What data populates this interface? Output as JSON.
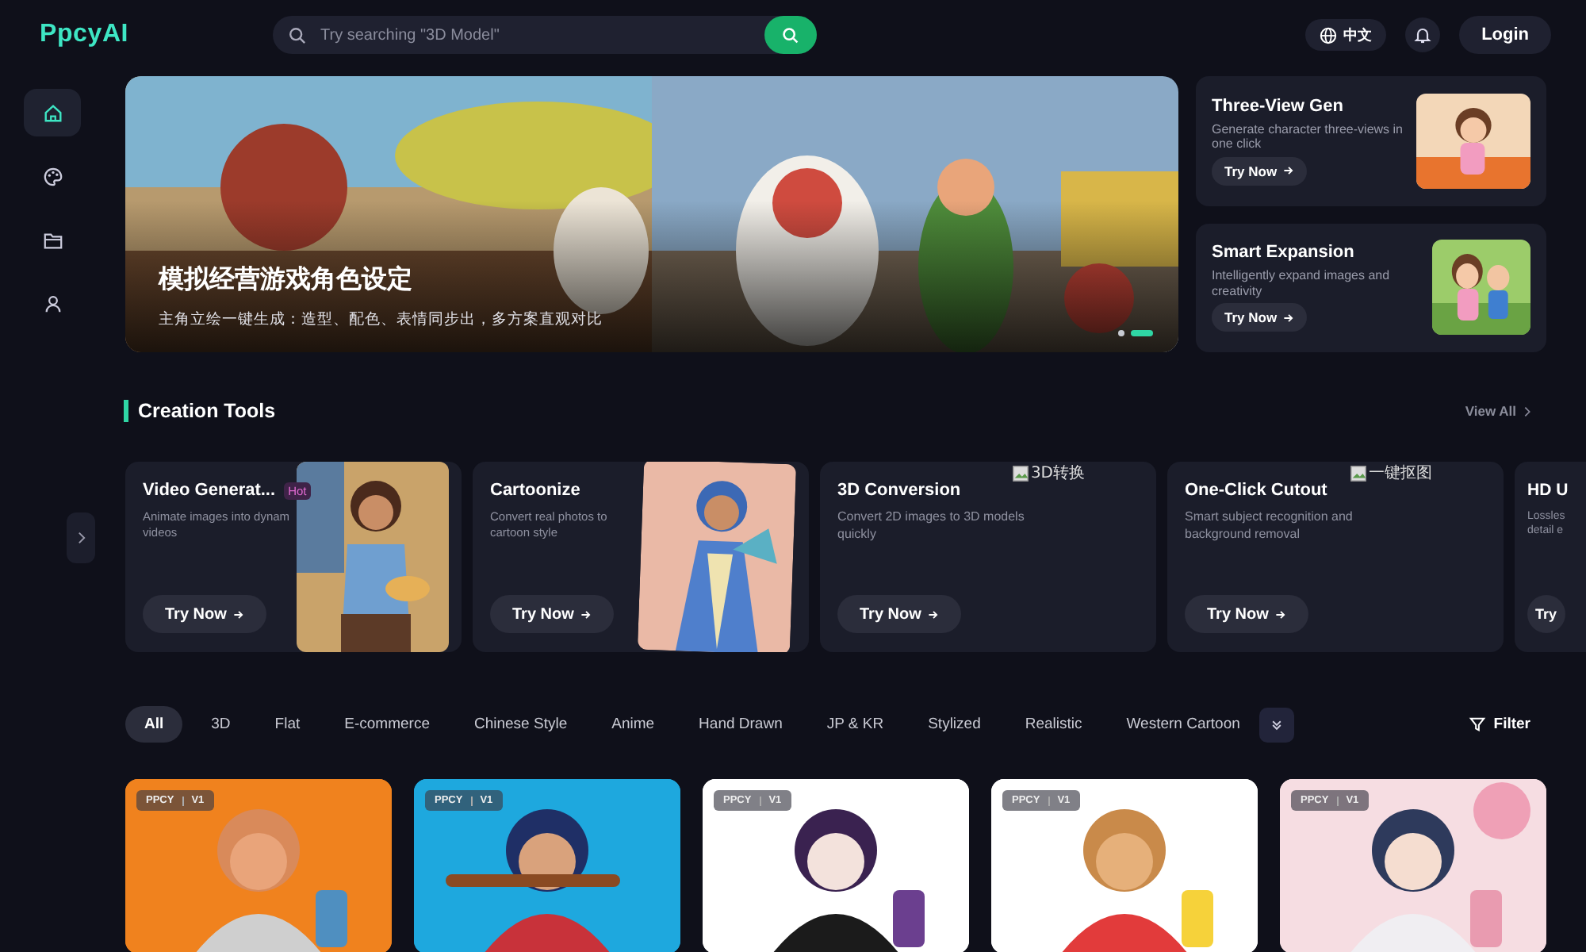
{
  "header": {
    "logo": "PpcyAI",
    "search": {
      "placeholder": "Try searching \"3D Model\""
    },
    "language": "中文",
    "login": "Login"
  },
  "sidebar": {
    "items": [
      {
        "selected": true
      },
      {
        "selected": false
      },
      {
        "selected": false
      },
      {
        "selected": false
      }
    ]
  },
  "hero": {
    "title": "模拟经营游戏角色设定",
    "subtitle": "主角立绘一键生成：造型、配色、表情同步出，多方案直观对比",
    "dots": [
      {
        "selected": false
      },
      {
        "selected": true
      }
    ]
  },
  "feature_cards": [
    {
      "title": "Three-View Gen",
      "description": "Generate character three-views in one click",
      "button": "Try Now"
    },
    {
      "title": "Smart Expansion",
      "description": "Intelligently expand images and creativity",
      "button": "Try Now"
    }
  ],
  "creation_tools": {
    "title": "Creation Tools",
    "view_all": "View All",
    "cards": [
      {
        "kind": "picture",
        "title": "Video Generat...",
        "badge": "Hot",
        "description": "Animate images into dynam videos",
        "button": "Try Now"
      },
      {
        "kind": "picture",
        "title": "Cartoonize",
        "description": "Convert real photos to cartoon style",
        "button": "Try Now"
      },
      {
        "kind": "broken",
        "title": "3D Conversion",
        "description": "Convert 2D images to 3D models quickly",
        "button": "Try Now",
        "image_alt": "3D转换"
      },
      {
        "kind": "broken",
        "title": "One-Click Cutout",
        "description": "Smart subject recognition and background removal",
        "button": "Try Now",
        "image_alt": "一键抠图"
      },
      {
        "kind": "cut",
        "title": "HD U",
        "description": "Lossles detail e",
        "button": "Try"
      }
    ]
  },
  "filters": {
    "chips": [
      {
        "label": "All",
        "selected": true
      },
      {
        "label": "3D",
        "selected": false
      },
      {
        "label": "Flat",
        "selected": false
      },
      {
        "label": "E-commerce",
        "selected": false
      },
      {
        "label": "Chinese Style",
        "selected": false
      },
      {
        "label": "Anime",
        "selected": false
      },
      {
        "label": "Hand Drawn",
        "selected": false
      },
      {
        "label": "JP & KR",
        "selected": false
      },
      {
        "label": "Stylized",
        "selected": false
      },
      {
        "label": "Realistic",
        "selected": false
      },
      {
        "label": "Western Cartoon",
        "selected": false
      }
    ],
    "filter": "Filter"
  },
  "gallery": [
    {
      "brand": "PPCY",
      "version": "V1",
      "color": "#f0821e"
    },
    {
      "brand": "PPCY",
      "version": "V1",
      "color": "#1ea8de"
    },
    {
      "brand": "PPCY",
      "version": "V1",
      "color": "#ffffff"
    },
    {
      "brand": "PPCY",
      "version": "V1",
      "color": "#ffffff"
    },
    {
      "brand": "PPCY",
      "version": "V1",
      "color": "#f6dde2"
    }
  ]
}
